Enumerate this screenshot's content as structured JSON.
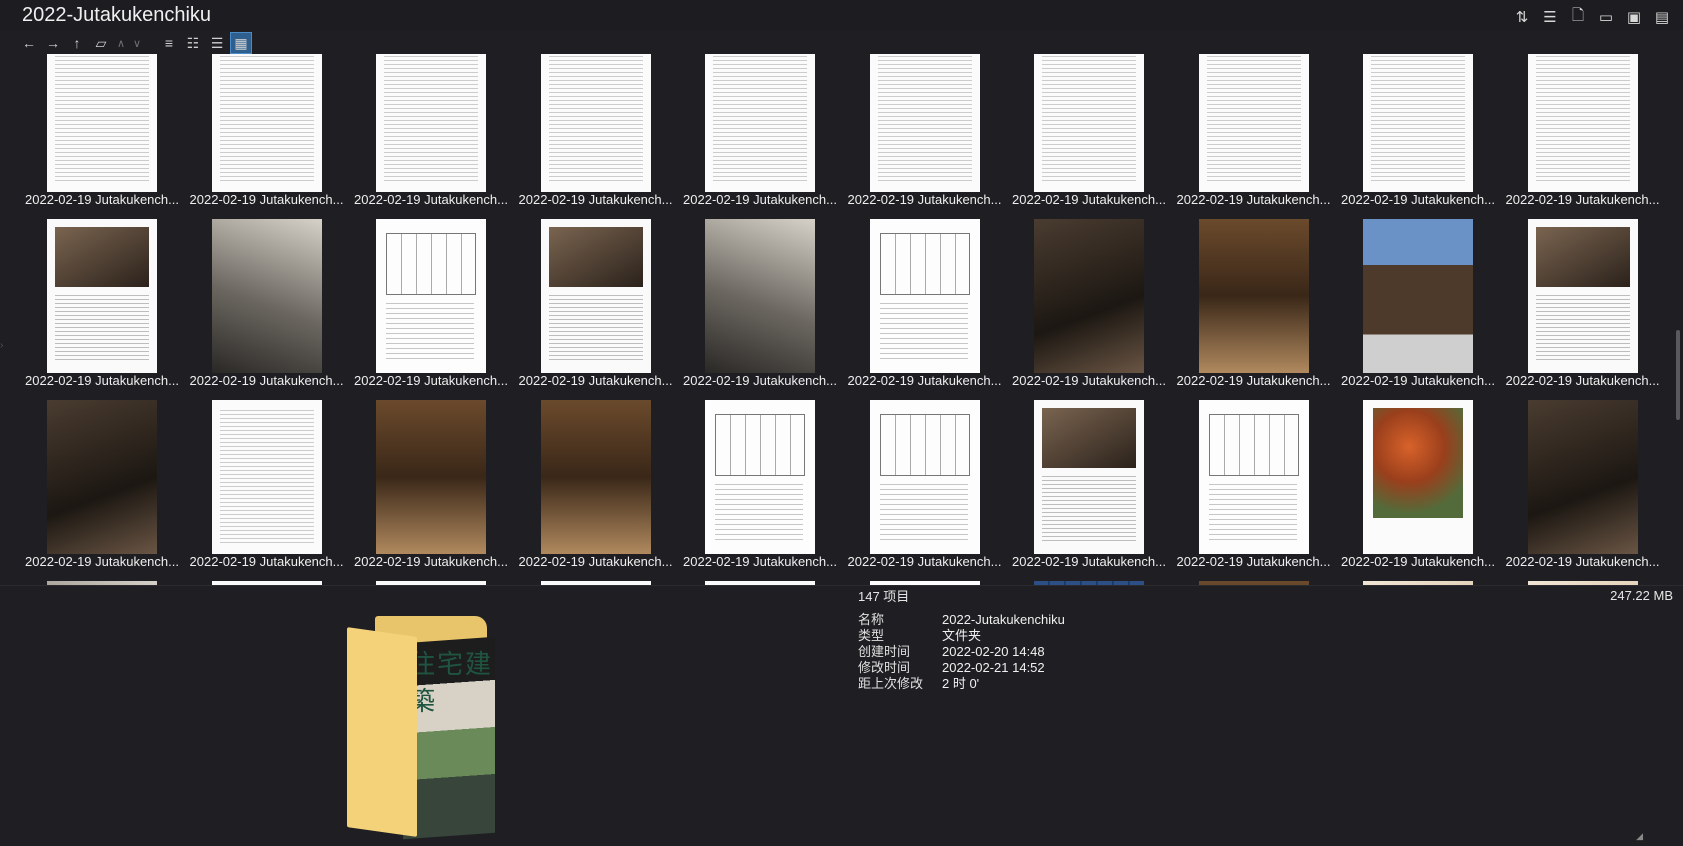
{
  "window": {
    "title": "2022-Jutakukenchiku"
  },
  "top_icons": [
    "sort-icon",
    "view-list-icon",
    "new-file-icon",
    "file-settings-icon",
    "preview-pane-icon",
    "clipboard-icon"
  ],
  "toolbar": {
    "buttons": [
      "back-arrow-icon",
      "forward-arrow-icon",
      "up-arrow-icon",
      "folder-nav-icon",
      "chevron-up-icon",
      "chevron-down-icon",
      "list-view-icon",
      "details-view-icon",
      "compact-view-icon",
      "thumbnail-view-icon"
    ],
    "active_view": "thumbnail-view-icon"
  },
  "grid": {
    "caption": "2022-02-19 Jutakukench...",
    "rows": [
      [
        "t-text",
        "t-text",
        "t-text",
        "t-text",
        "t-text",
        "t-text",
        "t-text",
        "t-text",
        "t-text",
        "t-text"
      ],
      [
        "t-mixed",
        "t-photo-grey",
        "t-drawing",
        "t-mixed",
        "t-photo-grey",
        "t-drawing",
        "t-photo-dark",
        "t-photo-warm",
        "t-house",
        "t-mixed"
      ],
      [
        "t-photo-dark",
        "t-text",
        "t-photo-warm",
        "t-photo-warm",
        "t-drawing",
        "t-drawing",
        "t-mixed",
        "t-drawing",
        "t-autumn",
        "t-photo-dark"
      ],
      [
        "t-photo-grey",
        "t-mixed",
        "t-mixed",
        "t-mixed",
        "t-mixed",
        "t-drawing",
        "t-tile",
        "t-photo-warm",
        "t-interior-lt",
        "t-interior-lt"
      ]
    ]
  },
  "folder_preview": {
    "label": "住宅建築"
  },
  "info": {
    "count": "147 项目",
    "size": "247.22 MB",
    "rows": [
      {
        "key": "名称",
        "value": "2022-Jutakukenchiku"
      },
      {
        "key": "类型",
        "value": "文件夹"
      },
      {
        "key": "创建时间",
        "value": "2022-02-20  14:48"
      },
      {
        "key": "修改时间",
        "value": "2022-02-21  14:52"
      },
      {
        "key": "距上次修改",
        "value": "2 时 0'"
      }
    ]
  }
}
